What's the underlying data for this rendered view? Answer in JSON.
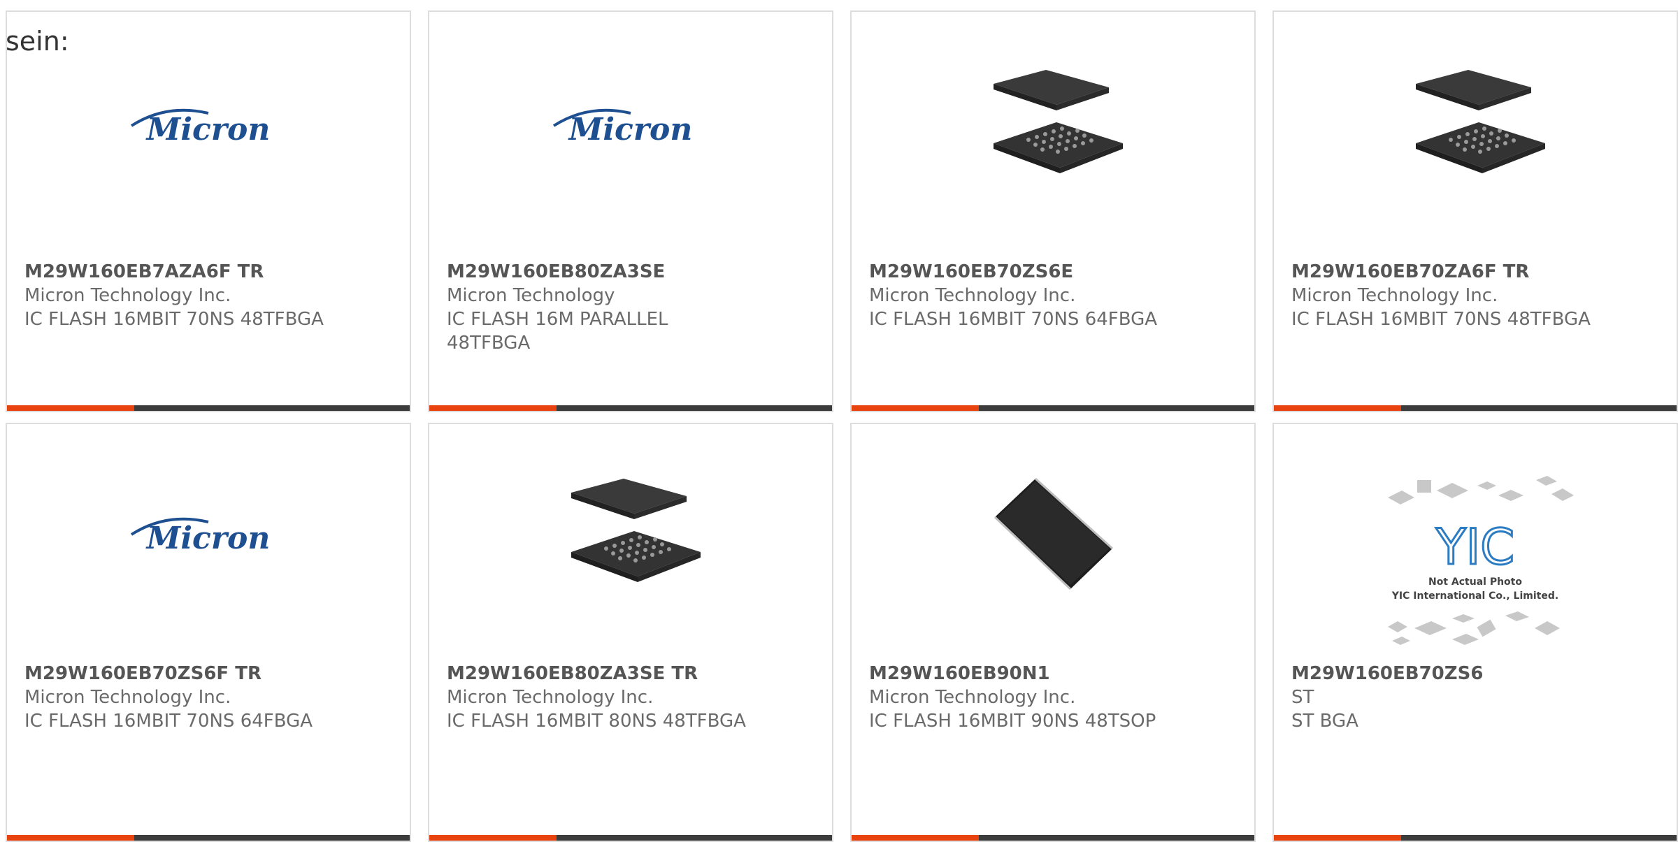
{
  "intro_text": "sein:",
  "colors": {
    "accent": "#e8430f",
    "bar_dark": "#3c3c3c",
    "border": "#dddddd",
    "micron_blue": "#1d4f91"
  },
  "cards": [
    {
      "part": "M29W160EB7AZA6F TR",
      "manufacturer": "Micron Technology Inc.",
      "description": "IC FLASH 16MBIT 70NS 48TFBGA",
      "image": "micron-logo",
      "logo_text": "Micron"
    },
    {
      "part": "M29W160EB80ZA3SE",
      "manufacturer": "Micron Technology",
      "description": "IC FLASH 16M PARALLEL 48TFBGA",
      "image": "micron-logo",
      "logo_text": "Micron"
    },
    {
      "part": "M29W160EB70ZS6E",
      "manufacturer": "Micron Technology Inc.",
      "description": "IC FLASH 16MBIT 70NS 64FBGA",
      "image": "bga-chip-photo"
    },
    {
      "part": "M29W160EB70ZA6F TR",
      "manufacturer": "Micron Technology Inc.",
      "description": "IC FLASH 16MBIT 70NS 48TFBGA",
      "image": "bga-chip-photo"
    },
    {
      "part": "M29W160EB70ZS6F TR",
      "manufacturer": "Micron Technology Inc.",
      "description": "IC FLASH 16MBIT 70NS 64FBGA",
      "image": "micron-logo",
      "logo_text": "Micron"
    },
    {
      "part": "M29W160EB80ZA3SE TR",
      "manufacturer": "Micron Technology Inc.",
      "description": "IC FLASH 16MBIT 80NS 48TFBGA",
      "image": "bga-chip-photo"
    },
    {
      "part": "M29W160EB90N1",
      "manufacturer": "Micron Technology Inc.",
      "description": "IC FLASH 16MBIT 90NS 48TSOP",
      "image": "tsop-chip-photo"
    },
    {
      "part": "M29W160EB70ZS6",
      "manufacturer": "ST",
      "description": "ST BGA",
      "image": "yic-placeholder",
      "placeholder_brand": "YIC",
      "placeholder_line1": "Not Actual Photo",
      "placeholder_line2": "YIC International Co., Limited."
    }
  ]
}
